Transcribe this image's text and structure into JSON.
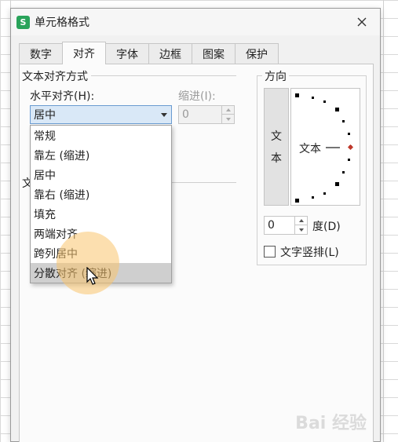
{
  "dialog": {
    "title": "单元格格式",
    "app_icon": "S"
  },
  "tabs": [
    {
      "label": "数字",
      "active": false
    },
    {
      "label": "对齐",
      "active": true
    },
    {
      "label": "字体",
      "active": false
    },
    {
      "label": "边框",
      "active": false
    },
    {
      "label": "图案",
      "active": false
    },
    {
      "label": "保护",
      "active": false
    }
  ],
  "alignment": {
    "group_title": "文本对齐方式",
    "horizontal_label": "水平对齐(H):",
    "horizontal_value": "居中",
    "indent_label": "缩进(I):",
    "indent_value": "0",
    "partial_text_label": "文"
  },
  "dropdown": {
    "options": [
      "常规",
      "靠左 (缩进)",
      "居中",
      "靠右 (缩进)",
      "填充",
      "两端对齐",
      "跨列居中",
      "分散对齐 (缩进)"
    ],
    "selected_index": 7
  },
  "orientation": {
    "title": "方向",
    "vertical_text": [
      "文",
      "本"
    ],
    "dial_text": "文本",
    "degree_value": "0",
    "degree_label": "度(D)",
    "vertical_checkbox_label": "文字竖排(L)",
    "vertical_checked": false
  },
  "colors": {
    "accent_green": "#29a35a",
    "highlight": "#fac46e",
    "dial_marker": "#c0392b"
  },
  "watermark": "Bai 经验"
}
